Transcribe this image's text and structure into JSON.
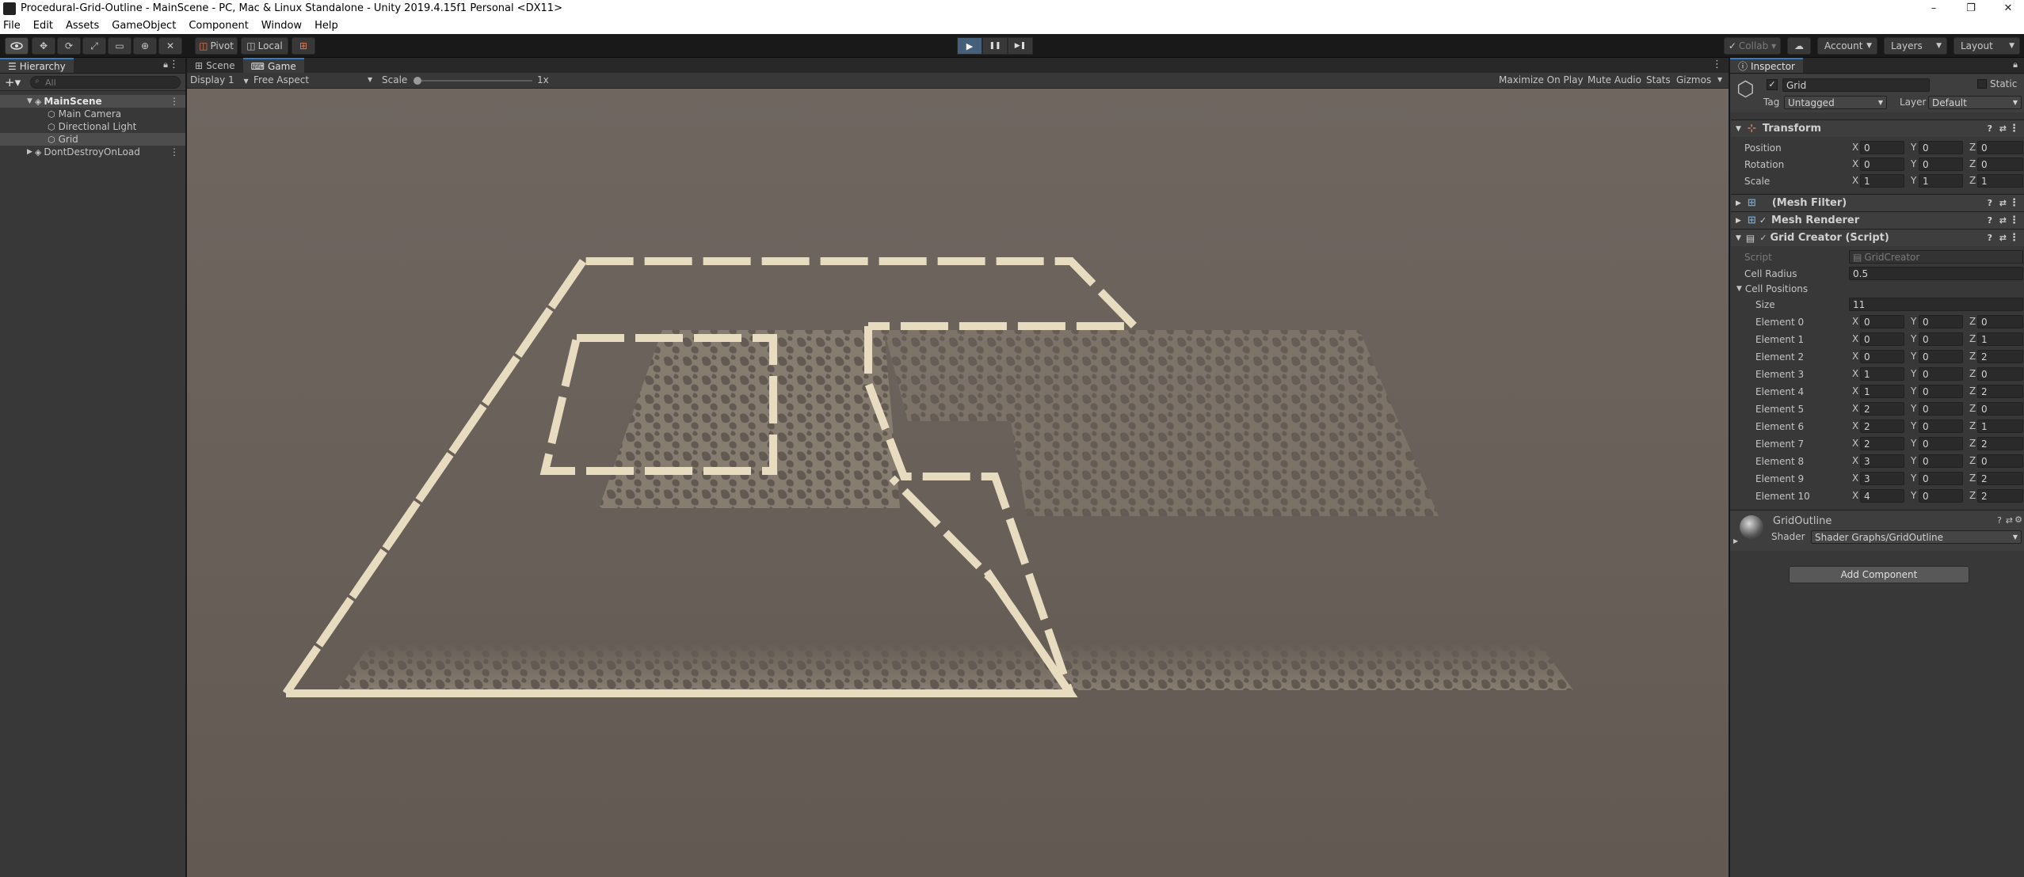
{
  "window": {
    "title": "Procedural-Grid-Outline - MainScene - PC, Mac & Linux Standalone - Unity 2019.4.15f1 Personal <DX11>",
    "minimize": "–",
    "maximize": "❐",
    "close": "✕"
  },
  "menu": [
    "File",
    "Edit",
    "Assets",
    "GameObject",
    "Component",
    "Window",
    "Help"
  ],
  "toolbar": {
    "pivot": "Pivot",
    "local": "Local",
    "collab": "Collab ▾",
    "account": "Account",
    "layers": "Layers",
    "layout": "Layout",
    "play": "▶",
    "pause": "❚❚",
    "step": "▶❚"
  },
  "hierarchy": {
    "tab": "Hierarchy",
    "search_placeholder": "All",
    "scene": "MainScene",
    "items": [
      "Main Camera",
      "Directional Light",
      "Grid"
    ],
    "dontdestroy": "DontDestroyOnLoad"
  },
  "center": {
    "tabs": [
      "Scene",
      "Game"
    ],
    "display": "Display 1",
    "aspect": "Free Aspect",
    "scale_label": "Scale",
    "scale_value": "1x",
    "maximize": "Maximize On Play",
    "mute": "Mute Audio",
    "stats": "Stats",
    "gizmos": "Gizmos"
  },
  "inspector": {
    "tab": "Inspector",
    "object_name": "Grid",
    "static_label": "Static",
    "tag_label": "Tag",
    "tag_value": "Untagged",
    "layer_label": "Layer",
    "layer_value": "Default",
    "transform": {
      "title": "Transform",
      "rows": [
        {
          "label": "Position",
          "x": "0",
          "y": "0",
          "z": "0"
        },
        {
          "label": "Rotation",
          "x": "0",
          "y": "0",
          "z": "0"
        },
        {
          "label": "Scale",
          "x": "1",
          "y": "1",
          "z": "1"
        }
      ]
    },
    "mesh_filter": "(Mesh Filter)",
    "mesh_renderer": "Mesh Renderer",
    "grid_creator": {
      "title": "Grid Creator (Script)",
      "script_label": "Script",
      "script_value": "GridCreator",
      "radius_label": "Cell Radius",
      "radius_value": "0.5",
      "positions_label": "Cell Positions",
      "size_label": "Size",
      "size_value": "11",
      "elements": [
        {
          "label": "Element 0",
          "x": "0",
          "y": "0",
          "z": "0"
        },
        {
          "label": "Element 1",
          "x": "0",
          "y": "0",
          "z": "1"
        },
        {
          "label": "Element 2",
          "x": "0",
          "y": "0",
          "z": "2"
        },
        {
          "label": "Element 3",
          "x": "1",
          "y": "0",
          "z": "0"
        },
        {
          "label": "Element 4",
          "x": "1",
          "y": "0",
          "z": "2"
        },
        {
          "label": "Element 5",
          "x": "2",
          "y": "0",
          "z": "0"
        },
        {
          "label": "Element 6",
          "x": "2",
          "y": "0",
          "z": "1"
        },
        {
          "label": "Element 7",
          "x": "2",
          "y": "0",
          "z": "2"
        },
        {
          "label": "Element 8",
          "x": "3",
          "y": "0",
          "z": "0"
        },
        {
          "label": "Element 9",
          "x": "3",
          "y": "0",
          "z": "2"
        },
        {
          "label": "Element 10",
          "x": "4",
          "y": "0",
          "z": "2"
        }
      ]
    },
    "material": {
      "name": "GridOutline",
      "shader_label": "Shader",
      "shader_value": "Shader Graphs/GridOutline"
    },
    "add_component": "Add Component"
  },
  "axis": {
    "x": "X",
    "y": "Y",
    "z": "Z"
  }
}
